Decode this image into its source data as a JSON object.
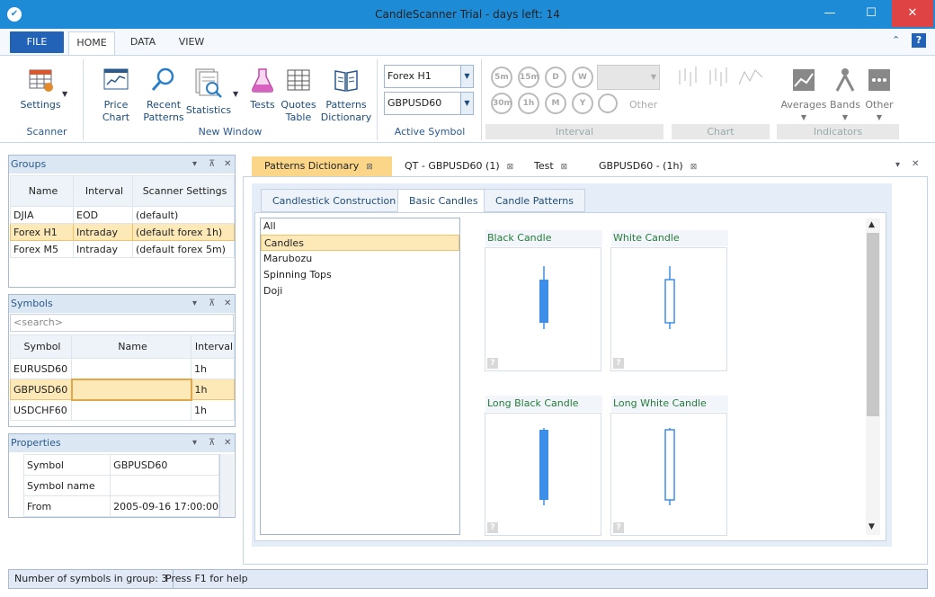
{
  "window": {
    "title": "CandleScanner Trial  - days left: 14",
    "minimize": "—",
    "maximize": "☐",
    "close": "✕"
  },
  "ribbon_tabs": {
    "file": "FILE",
    "home": "HOME",
    "data": "DATA",
    "view": "VIEW"
  },
  "ribbon": {
    "settings": "Settings",
    "price_chart": "Price Chart",
    "recent_patterns_1": "Recent",
    "recent_patterns_2": "Patterns",
    "statistics": "Statistics",
    "tests": "Tests",
    "quotes_table_1": "Quotes",
    "quotes_table_2": "Table",
    "patterns_dict_1": "Patterns",
    "patterns_dict_2": "Dictionary",
    "group_combo": "Forex H1",
    "symbol_combo": "GBPUSD60",
    "interval_buttons": [
      "5m",
      "15m",
      "D",
      "W",
      "30m",
      "1h",
      "M",
      "Y"
    ],
    "other_interval": "Other",
    "averages": "Averages",
    "bands": "Bands",
    "other_indicators": "Other",
    "groups": {
      "scanner": "Scanner",
      "new_window": "New Window",
      "active_symbol": "Active Symbol",
      "interval": "Interval",
      "chart": "Chart",
      "indicators": "Indicators"
    }
  },
  "groups_panel": {
    "title": "Groups",
    "columns": [
      "Name",
      "Interval",
      "Scanner Settings"
    ],
    "rows": [
      [
        "DJIA",
        "EOD",
        "(default)"
      ],
      [
        "Forex H1",
        "Intraday",
        "(default forex 1h)"
      ],
      [
        "Forex M5",
        "Intraday",
        "(default forex 5m)"
      ]
    ]
  },
  "symbols_panel": {
    "title": "Symbols",
    "search_placeholder": "<search>",
    "columns": [
      "Symbol",
      "Name",
      "Interval"
    ],
    "rows": [
      [
        "EURUSD60",
        "",
        "1h"
      ],
      [
        "GBPUSD60",
        "",
        "1h"
      ],
      [
        "USDCHF60",
        "",
        "1h"
      ]
    ]
  },
  "properties_panel": {
    "title": "Properties",
    "rows": [
      [
        "Symbol",
        "GBPUSD60"
      ],
      [
        "Symbol name",
        ""
      ],
      [
        "From",
        "2005-09-16 17:00:00"
      ]
    ]
  },
  "panel_controls": {
    "dropdown": "▾",
    "pin": "⊼",
    "close": "✕"
  },
  "doc_tabs": [
    "Patterns Dictionary",
    "QT - GBPUSD60 (1)",
    "Test",
    "GBPUSD60 - (1h)"
  ],
  "inner_tabs": [
    "Candlestick Construction",
    "Basic Candles",
    "Candle Patterns"
  ],
  "categories": [
    "All",
    "Candles",
    "Marubozu",
    "Spinning Tops",
    "Doji"
  ],
  "candles": [
    {
      "title": "Black Candle"
    },
    {
      "title": "White Candle"
    },
    {
      "title": "Long Black Candle"
    },
    {
      "title": "Long White Candle"
    }
  ],
  "help_mark": "?",
  "status": {
    "symbols_count": "Number of symbols in group: 3",
    "help": "Press F1 for help"
  },
  "colors": {
    "titlebar": "#1e8bd7",
    "selection": "#fde8b8",
    "candle_fill": "#3d8ee8"
  }
}
